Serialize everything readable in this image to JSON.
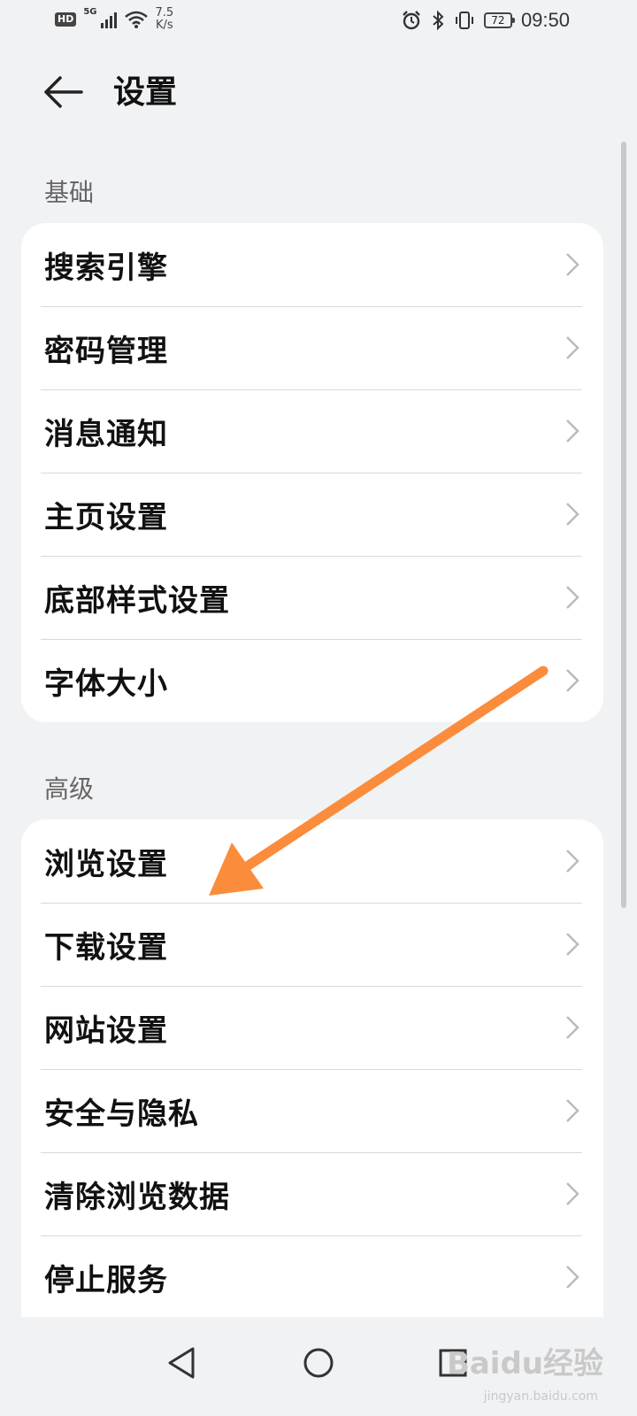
{
  "status_bar": {
    "hd": "HD",
    "network": "5G",
    "speed_value": "7.5",
    "speed_unit": "K/s",
    "battery": "72",
    "time": "09:50"
  },
  "header": {
    "title": "设置"
  },
  "sections": [
    {
      "label": "基础",
      "items": [
        "搜索引擎",
        "密码管理",
        "消息通知",
        "主页设置",
        "底部样式设置",
        "字体大小"
      ]
    },
    {
      "label": "高级",
      "items": [
        "浏览设置",
        "下载设置",
        "网站设置",
        "安全与隐私",
        "清除浏览数据",
        "停止服务"
      ]
    }
  ],
  "watermark": {
    "brand": "Baidu经验",
    "url": "jingyan.baidu.com"
  },
  "colors": {
    "background": "#f1f2f4",
    "card": "#ffffff",
    "annotation_arrow": "#fb8c3c"
  }
}
